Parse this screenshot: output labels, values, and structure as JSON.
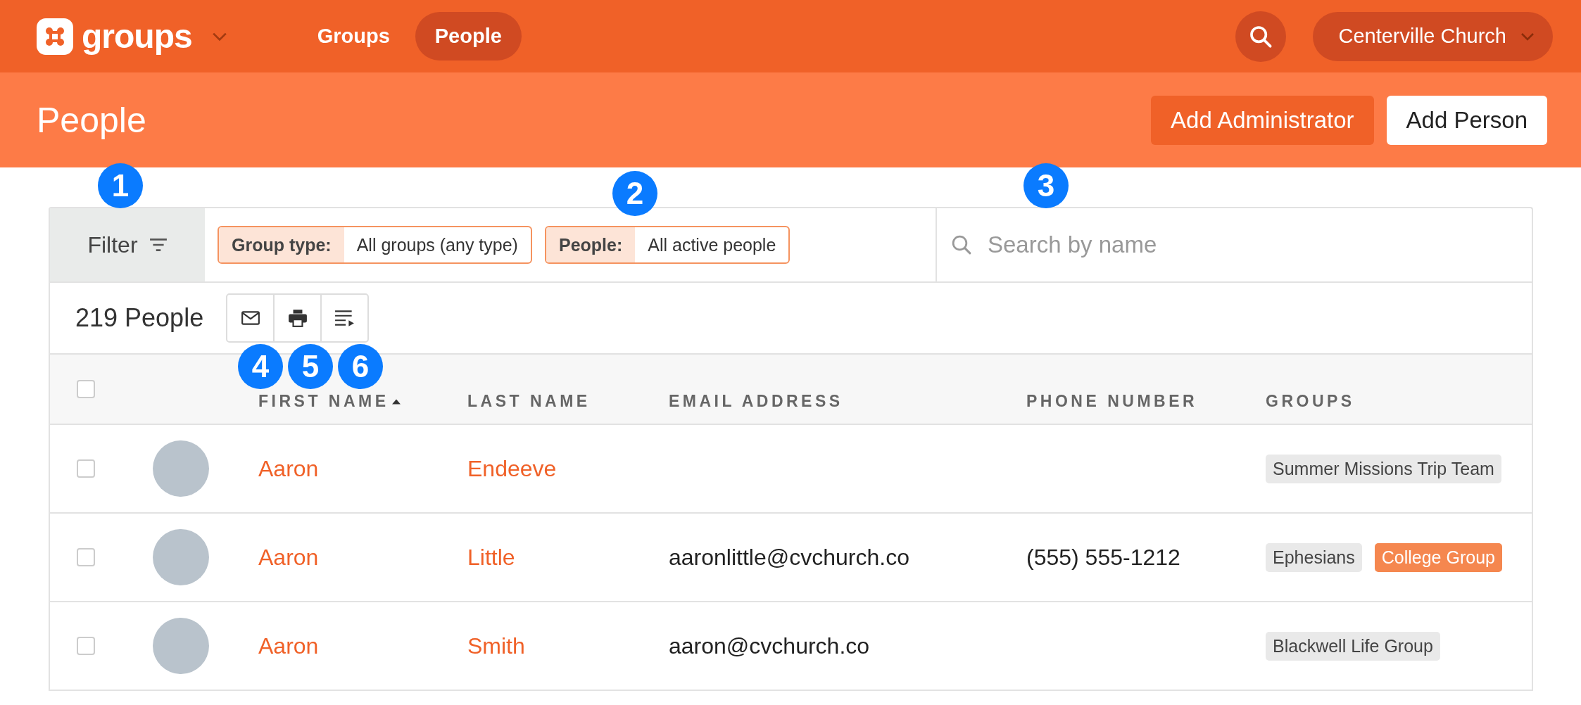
{
  "topbar": {
    "brand": "groups",
    "nav": [
      {
        "label": "Groups",
        "selected": false
      },
      {
        "label": "People",
        "selected": true
      }
    ],
    "account": "Centerville Church"
  },
  "header": {
    "title": "People",
    "buttons": [
      {
        "label": "Add Administrator",
        "kind": "primary"
      },
      {
        "label": "Add Person",
        "kind": "secondary"
      }
    ]
  },
  "filter_bar": {
    "filter_label": "Filter",
    "chips": [
      {
        "label": "Group type:",
        "value": "All groups (any type)"
      },
      {
        "label": "People:",
        "value": "All active people"
      }
    ],
    "search": {
      "placeholder": "Search by name"
    }
  },
  "count": "219 People",
  "table": {
    "columns": [
      {
        "label": "FIRST NAME",
        "sorted": true
      },
      {
        "label": "LAST NAME",
        "sorted": false
      },
      {
        "label": "EMAIL ADDRESS",
        "sorted": false
      },
      {
        "label": "PHONE NUMBER",
        "sorted": false
      },
      {
        "label": "GROUPS",
        "sorted": false
      }
    ],
    "select_all": {
      "checked": false
    },
    "rows": [
      {
        "checked": false,
        "first": "Aaron",
        "last": "Endeeve",
        "email": "",
        "phone": "",
        "groups": [
          {
            "label": "Summer Missions Trip Team",
            "color": "#e9e9e9"
          }
        ]
      },
      {
        "checked": false,
        "first": "Aaron",
        "last": "Little",
        "email": "aaronlittle@cvchurch.co",
        "phone": "(555) 555-1212",
        "groups": [
          {
            "label": "Ephesians",
            "color": "#e9e9e9"
          },
          {
            "label": "College Group",
            "color": "#f5874f"
          }
        ]
      },
      {
        "checked": false,
        "first": "Aaron",
        "last": "Smith",
        "email": "aaron@cvchurch.co",
        "phone": "",
        "groups": [
          {
            "label": "Blackwell Life Group",
            "color": "#e9e9e9"
          }
        ]
      }
    ]
  },
  "callouts": [
    "1",
    "2",
    "3",
    "4",
    "5",
    "6"
  ]
}
